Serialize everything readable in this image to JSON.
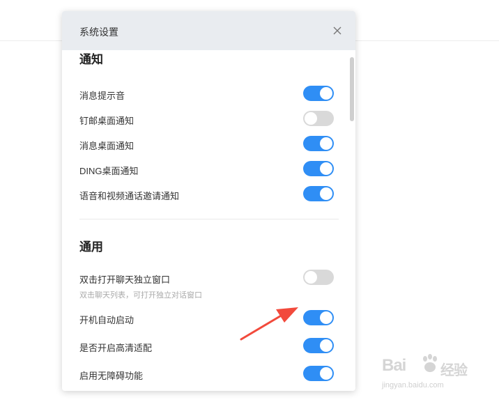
{
  "dialog": {
    "title": "系统设置"
  },
  "notifications": {
    "section_title": "通知",
    "items": [
      {
        "label": "消息提示音",
        "on": true
      },
      {
        "label": "钉邮桌面通知",
        "on": false
      },
      {
        "label": "消息桌面通知",
        "on": true
      },
      {
        "label": "DING桌面通知",
        "on": true
      },
      {
        "label": "语音和视频通话邀请通知",
        "on": true
      }
    ]
  },
  "general": {
    "section_title": "通用",
    "items": [
      {
        "label": "双击打开聊天独立窗口",
        "description": "双击聊天列表，可打开独立对话窗口",
        "on": false
      },
      {
        "label": "开机自动启动",
        "on": true
      },
      {
        "label": "是否开启高清适配",
        "on": true
      },
      {
        "label": "启用无障碍功能",
        "on": true
      }
    ]
  },
  "watermark": {
    "brand": "Bai",
    "brand_cn": "经验",
    "url": "jingyan.baidu.com"
  },
  "colors": {
    "toggle_on": "#2f8ef5",
    "toggle_off": "#d9d9d9",
    "arrow": "#f24a3c",
    "header_bg": "#e9ecf0"
  }
}
